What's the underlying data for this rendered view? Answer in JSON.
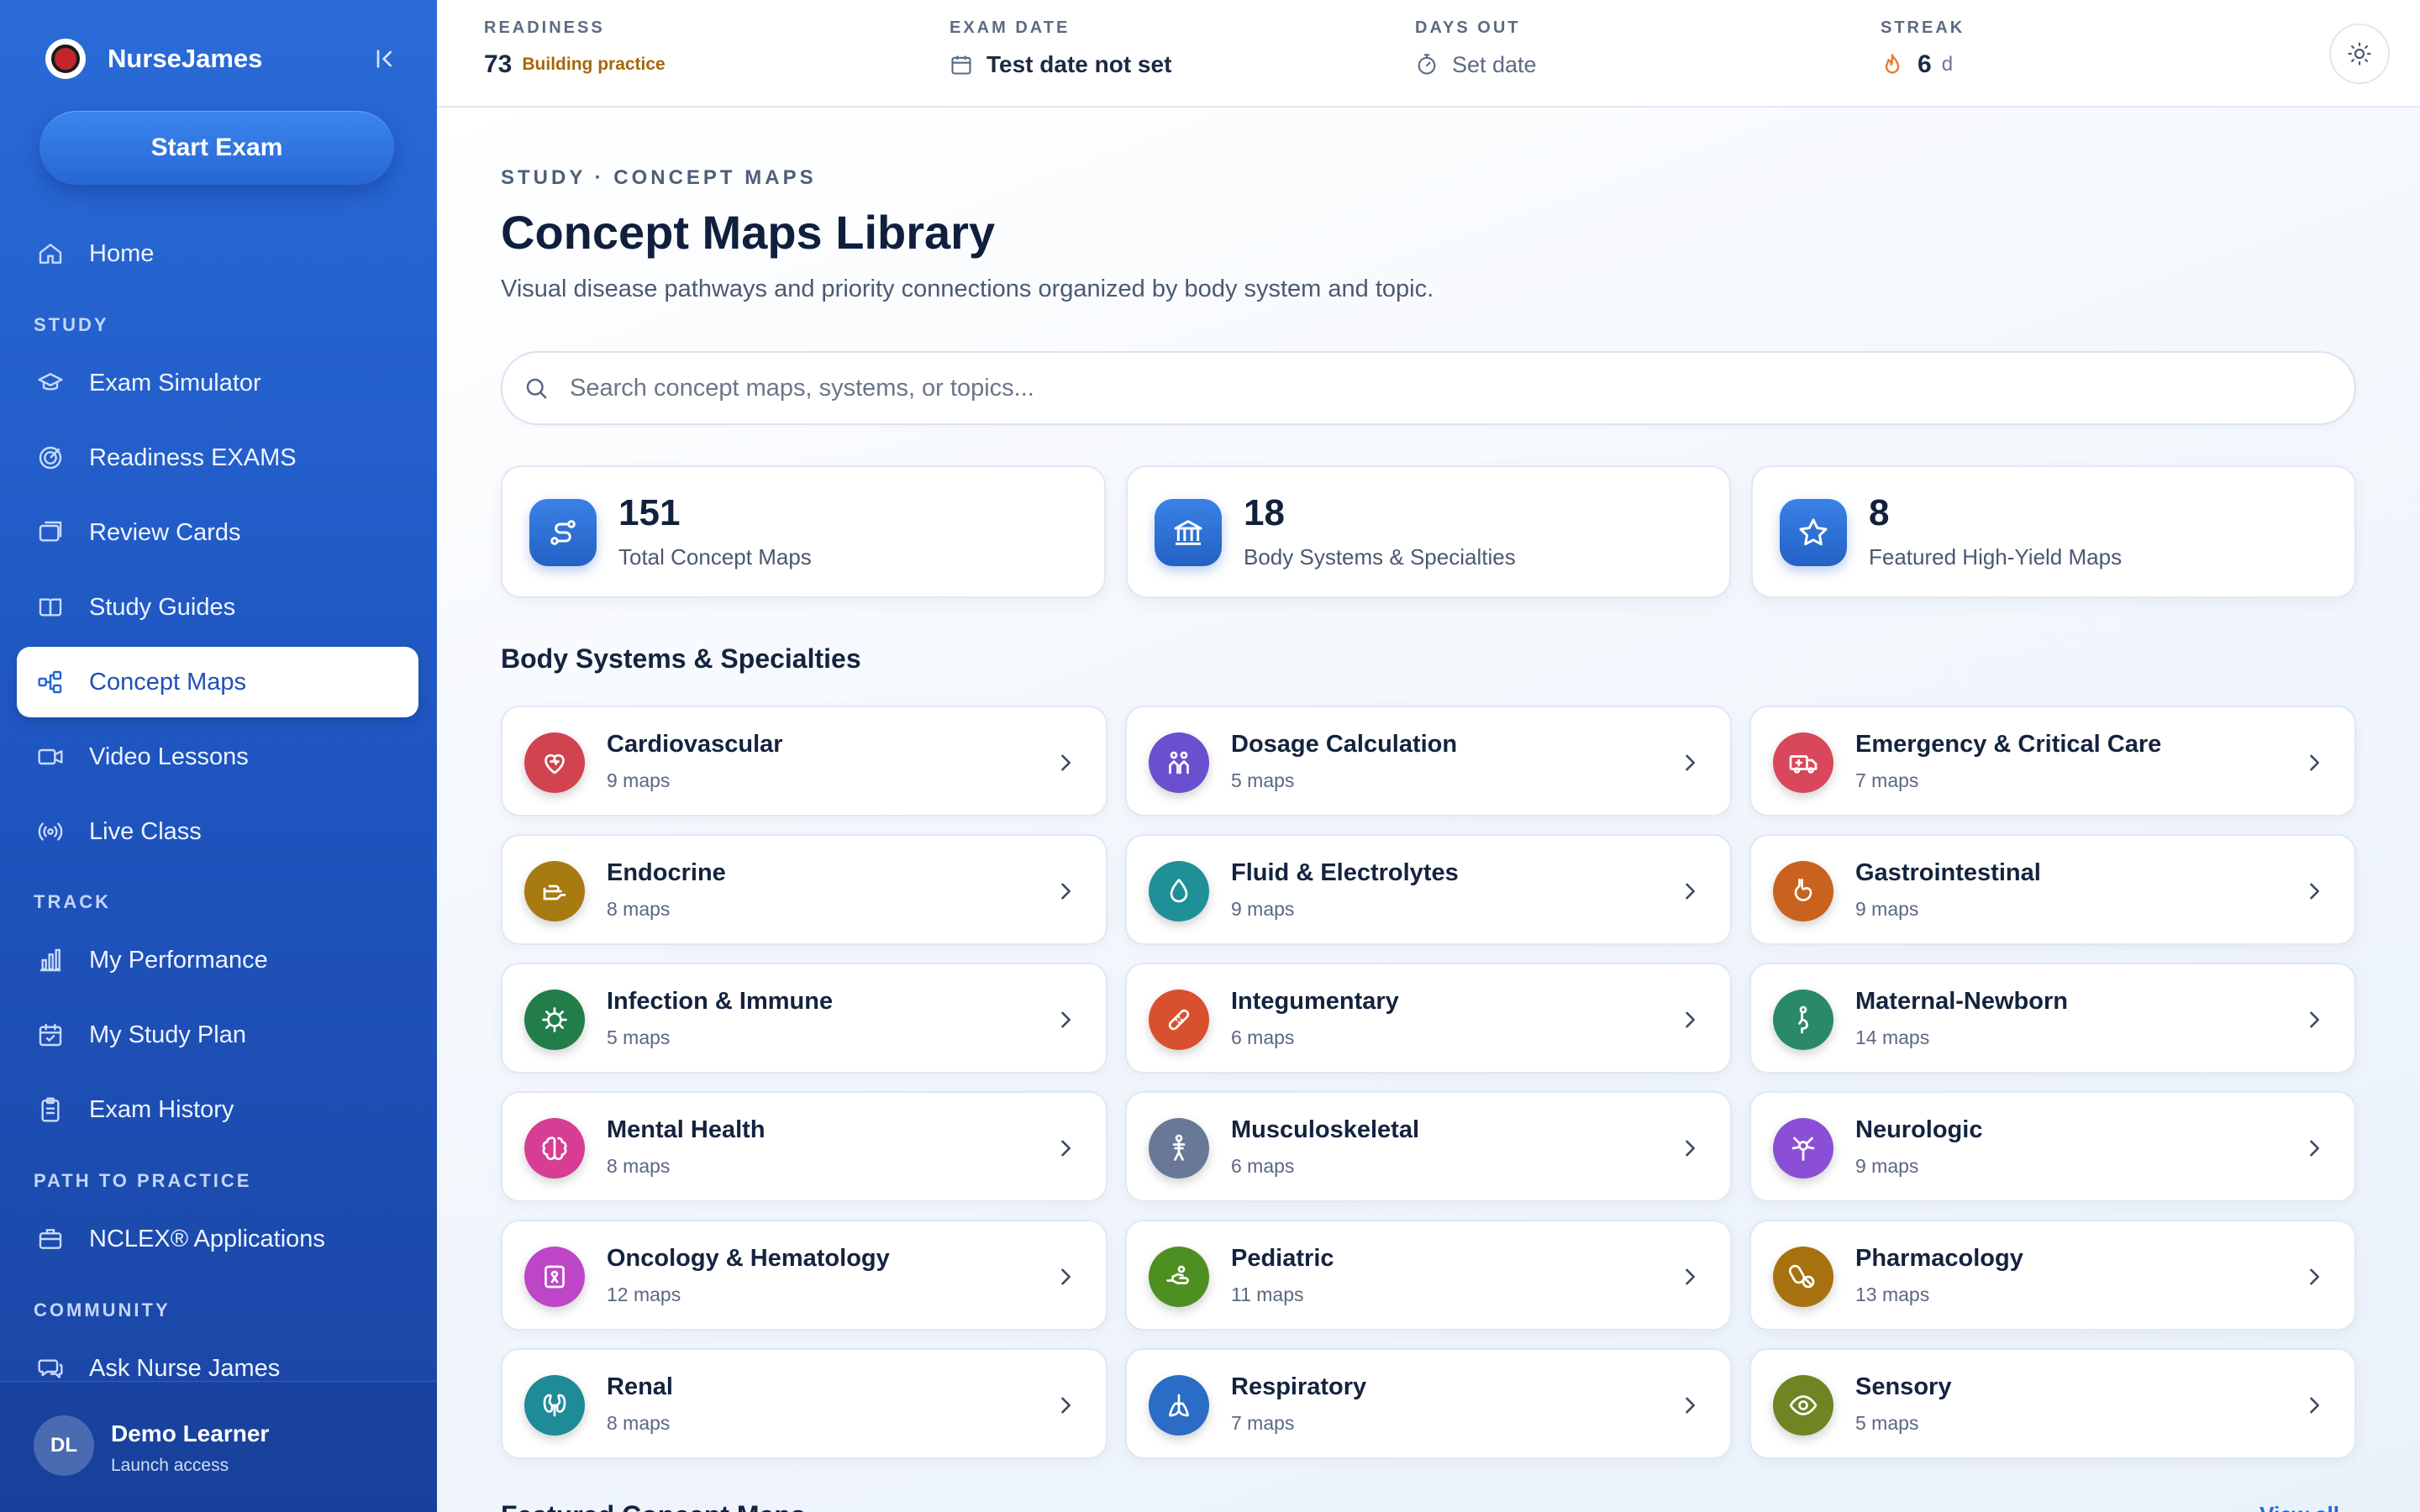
{
  "sidebar": {
    "brand_name": "NurseJames",
    "start_exam": "Start Exam",
    "home": "Home",
    "sections": {
      "study": "STUDY",
      "track": "TRACK",
      "path": "PATH TO PRACTICE",
      "community": "COMMUNITY"
    },
    "study_items": [
      "Exam Simulator",
      "Readiness EXAMS",
      "Review Cards",
      "Study Guides",
      "Concept Maps",
      "Video Lessons",
      "Live Class"
    ],
    "track_items": [
      "My Performance",
      "My Study Plan",
      "Exam History"
    ],
    "path_items": [
      "NCLEX® Applications"
    ],
    "community_items": [
      "Ask Nurse James"
    ],
    "active": "Concept Maps",
    "user": {
      "initials": "DL",
      "name": "Demo Learner",
      "sub": "Launch access"
    }
  },
  "topbar": {
    "readiness": {
      "label": "READINESS",
      "value": "73",
      "badge": "Building practice"
    },
    "exam_date": {
      "label": "EXAM DATE",
      "value": "Test date not set"
    },
    "days_out": {
      "label": "DAYS OUT",
      "value": "Set date"
    },
    "streak": {
      "label": "STREAK",
      "value": "6",
      "unit": "d"
    }
  },
  "main": {
    "breadcrumb": "STUDY · CONCEPT MAPS",
    "title": "Concept Maps Library",
    "description": "Visual disease pathways and priority connections organized by body system and topic.",
    "search_placeholder": "Search concept maps, systems, or topics...",
    "stats": [
      {
        "value": "151",
        "label": "Total Concept Maps",
        "icon": "route-icon"
      },
      {
        "value": "18",
        "label": "Body Systems & Specialties",
        "icon": "institution-icon"
      },
      {
        "value": "8",
        "label": "Featured High-Yield Maps",
        "icon": "star-icon"
      }
    ],
    "systems_title": "Body Systems & Specialties",
    "systems": [
      {
        "name": "Cardiovascular",
        "count": "9 maps",
        "color": "#d0434f",
        "icon": "heart-icon"
      },
      {
        "name": "Dosage Calculation",
        "count": "5 maps",
        "color": "#6a50cf",
        "icon": "people-icon"
      },
      {
        "name": "Emergency & Critical Care",
        "count": "7 maps",
        "color": "#d8485a",
        "icon": "ambulance-icon"
      },
      {
        "name": "Endocrine",
        "count": "8 maps",
        "color": "#a77a12",
        "icon": "hand-pointer-icon"
      },
      {
        "name": "Fluid & Electrolytes",
        "count": "9 maps",
        "color": "#1f8f98",
        "icon": "droplet-icon"
      },
      {
        "name": "Gastrointestinal",
        "count": "9 maps",
        "color": "#c9621f",
        "icon": "stomach-icon"
      },
      {
        "name": "Infection & Immune",
        "count": "5 maps",
        "color": "#227d4a",
        "icon": "virus-icon"
      },
      {
        "name": "Integumentary",
        "count": "6 maps",
        "color": "#d9502e",
        "icon": "bandage-icon"
      },
      {
        "name": "Maternal-Newborn",
        "count": "14 maps",
        "color": "#2a8a68",
        "icon": "pregnancy-icon"
      },
      {
        "name": "Mental Health",
        "count": "8 maps",
        "color": "#d63d93",
        "icon": "brain-icon"
      },
      {
        "name": "Musculoskeletal",
        "count": "6 maps",
        "color": "#687896",
        "icon": "skeleton-icon"
      },
      {
        "name": "Neurologic",
        "count": "9 maps",
        "color": "#8a4fd6",
        "icon": "neuron-icon"
      },
      {
        "name": "Oncology & Hematology",
        "count": "12 maps",
        "color": "#bd45c8",
        "icon": "ribbon-icon"
      },
      {
        "name": "Pediatric",
        "count": "11 maps",
        "color": "#4e8f22",
        "icon": "baby-hand-icon"
      },
      {
        "name": "Pharmacology",
        "count": "13 maps",
        "color": "#a8710f",
        "icon": "pills-icon"
      },
      {
        "name": "Renal",
        "count": "8 maps",
        "color": "#1f8a98",
        "icon": "kidney-icon"
      },
      {
        "name": "Respiratory",
        "count": "7 maps",
        "color": "#2a6cc6",
        "icon": "lungs-icon"
      },
      {
        "name": "Sensory",
        "count": "5 maps",
        "color": "#6f8422",
        "icon": "eye-icon"
      }
    ],
    "featured_title": "Featured Concept Maps",
    "view_all": "View all"
  }
}
